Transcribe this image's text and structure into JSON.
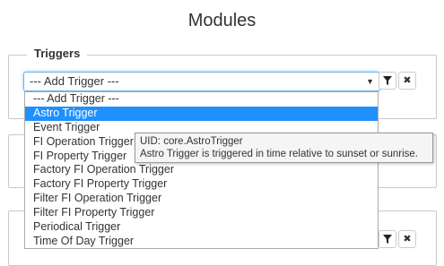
{
  "page": {
    "title": "Modules"
  },
  "triggers": {
    "legend": "Triggers",
    "select_value": "--- Add Trigger ---",
    "filter_icon": "filter-icon",
    "remove_icon": "close-icon",
    "options": [
      "--- Add Trigger ---",
      "Astro Trigger",
      "Event Trigger",
      "FI Operation Trigger",
      "FI Property Trigger",
      "Factory FI Operation Trigger",
      "Factory FI Property Trigger",
      "Filter FI Operation Trigger",
      "Filter FI Property Trigger",
      "Periodical Trigger",
      "Time Of Day Trigger"
    ],
    "selected_index": 1
  },
  "tooltip": {
    "uid": "UID: core.AstroTrigger",
    "description": "Astro Trigger is triggered in time relative to sunset or sunrise."
  },
  "colors": {
    "highlight": "#1e90ff",
    "focus_border": "#66afe9"
  }
}
